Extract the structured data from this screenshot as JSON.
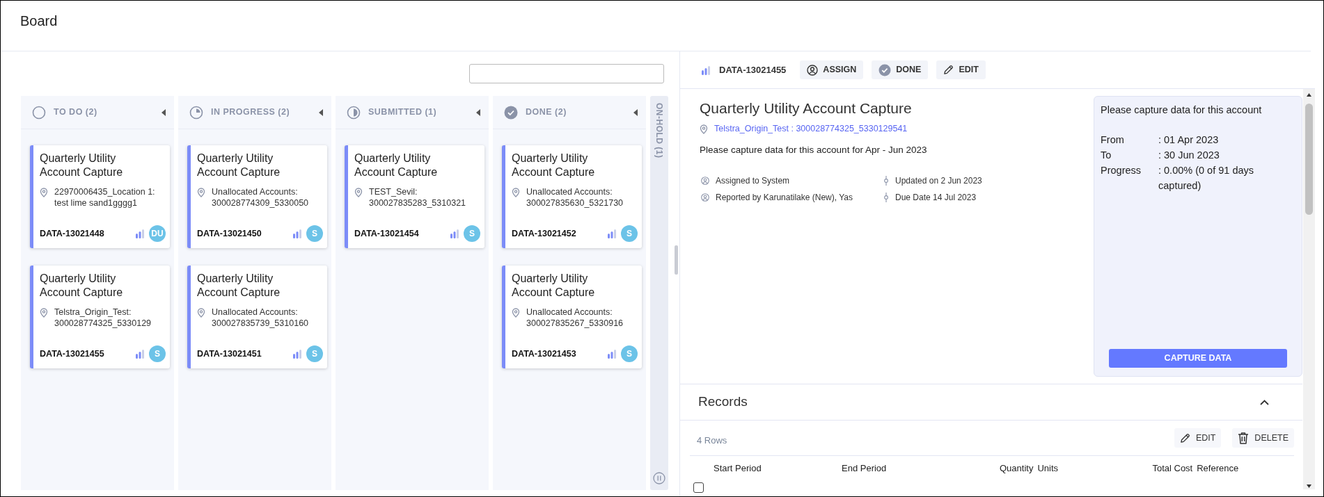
{
  "header": {
    "title": "Board"
  },
  "columns": [
    {
      "title": "TO DO (2)",
      "kind": "todo",
      "cards": [
        {
          "title": "Quarterly Utility Account Capture",
          "location": "22970006435_Location 1: test lime sand1gggg1",
          "id": "DATA-13021448",
          "avatar": "DU"
        },
        {
          "title": "Quarterly Utility Account Capture",
          "location": "Telstra_Origin_Test: 300028774325_5330129",
          "id": "DATA-13021455",
          "avatar": "S"
        }
      ]
    },
    {
      "title": "IN PROGRESS (2)",
      "kind": "progress",
      "cards": [
        {
          "title": "Quarterly Utility Account Capture",
          "location": "Unallocated Accounts: 300028774309_5330050",
          "id": "DATA-13021450",
          "avatar": "S"
        },
        {
          "title": "Quarterly Utility Account Capture",
          "location": "Unallocated Accounts: 300027835739_5310160",
          "id": "DATA-13021451",
          "avatar": "S"
        }
      ]
    },
    {
      "title": "SUBMITTED (1)",
      "kind": "submitted",
      "cards": [
        {
          "title": "Quarterly Utility Account Capture",
          "location": "TEST_Sevil: 300027835283_5310321",
          "id": "DATA-13021454",
          "avatar": "S"
        }
      ]
    },
    {
      "title": "DONE (2)",
      "kind": "done",
      "cards": [
        {
          "title": "Quarterly Utility Account Capture",
          "location": "Unallocated Accounts: 300027835630_5321730",
          "id": "DATA-13021452",
          "avatar": "S"
        },
        {
          "title": "Quarterly Utility Account Capture",
          "location": "Unallocated Accounts: 300027835267_5330916",
          "id": "DATA-13021453",
          "avatar": "S"
        }
      ]
    }
  ],
  "on_hold": {
    "title": "ON-HOLD (1)"
  },
  "detail": {
    "toolbar": {
      "id": "DATA-13021455",
      "buttons": [
        {
          "label": "ASSIGN",
          "kind": "assign"
        },
        {
          "label": "DONE",
          "kind": "done"
        },
        {
          "label": "EDIT",
          "kind": "edit"
        }
      ]
    },
    "title": "Quarterly Utility Account Capture",
    "location": "Telstra_Origin_Test : 300028774325_5330129541",
    "description": "Please capture data for this account for Apr - Jun 2023",
    "meta": [
      {
        "kind": "person",
        "text": "Assigned to System"
      },
      {
        "kind": "milestone",
        "text": "Updated on 2 Jun 2023"
      },
      {
        "kind": "person",
        "text": "Reported by Karunatilake (New), Yas"
      },
      {
        "kind": "milestone",
        "text": "Due Date 14 Jul 2023"
      }
    ],
    "info": {
      "heading": "Please capture data for this account",
      "rows": [
        {
          "label": "From",
          "value": ": 01 Apr 2023"
        },
        {
          "label": "To",
          "value": ": 30 Jun 2023"
        },
        {
          "label": "Progress",
          "value": ": 0.00% (0 of 91 days captured)"
        }
      ],
      "button": "CAPTURE DATA"
    }
  },
  "records": {
    "title": "Records",
    "expanded": true,
    "count": "4 Rows",
    "actions": [
      {
        "label": "EDIT",
        "kind": "edit"
      },
      {
        "label": "DELETE",
        "kind": "delete"
      }
    ],
    "columns": [
      "Start Period",
      "End Period",
      "Quantity",
      "Units",
      "Total Cost",
      "Reference"
    ],
    "rows": [
      {
        "checked": false
      }
    ]
  }
}
